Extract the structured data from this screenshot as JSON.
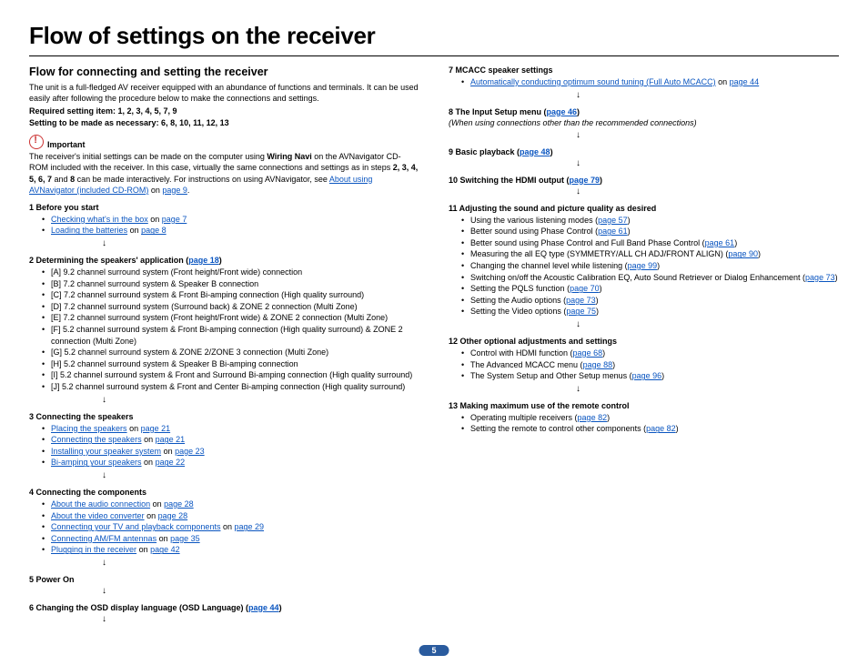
{
  "title": "Flow of settings on the receiver",
  "subtitle": "Flow for connecting and setting the receiver",
  "intro1": "The unit is a full-fledged AV receiver equipped with an abundance of functions and terminals. It can be used easily after following the procedure below to make the connections and settings.",
  "req_label": "Required setting item",
  "req_val": ": 1, 2, 3, 4, 5, 7, 9",
  "asnec_label": "Setting to be made as necessary",
  "asnec_val": ": 6, 8, 10, 11, 12, 13",
  "important_label": "Important",
  "important_a": "The receiver's initial settings can be made on the computer using ",
  "important_wn": "Wiring Navi",
  "important_b": " on the AVNavigator CD-ROM included with the receiver. In this case, virtually the same connections and settings as in steps ",
  "important_steps": "2, 3, 4, 5, 6, 7",
  "important_c": " and ",
  "important_8": "8",
  "important_d": " can be made interactively. For instructions on using AVNavigator, see ",
  "important_link": "About using AVNavigator (included CD-ROM)",
  "important_e": " on ",
  "important_pg": "page 9",
  "s1_head": "1    Before you start",
  "s1a_a": "Checking what's in the box",
  "s1a_b": " on ",
  "s1a_pg": "page 7",
  "s1b_a": "Loading the batteries",
  "s1b_b": " on ",
  "s1b_pg": "page 8",
  "s2_head_a": "2    Determining the speakers' application (",
  "s2_head_pg": "page 18",
  "s2_head_b": ")",
  "s2_A": "[A] 9.2 channel surround system (Front height/Front wide) connection",
  "s2_B": "[B] 7.2 channel surround system & Speaker B connection",
  "s2_C": "[C] 7.2 channel surround system & Front Bi-amping connection (High quality surround)",
  "s2_D": "[D] 7.2 channel surround system (Surround back) & ZONE 2 connection (Multi Zone)",
  "s2_E": "[E] 7.2 channel surround system (Front height/Front wide) & ZONE 2 connection (Multi Zone)",
  "s2_F": "[F] 5.2 channel surround system & Front Bi-amping connection (High quality surround) & ZONE 2 connection (Multi Zone)",
  "s2_G": "[G] 5.2 channel surround system & ZONE 2/ZONE 3 connection (Multi Zone)",
  "s2_H": "[H] 5.2 channel surround system & Speaker B Bi-amping connection",
  "s2_I": "[I] 5.2 channel surround system & Front and Surround Bi-amping connection (High quality surround)",
  "s2_J": "[J] 5.2 channel surround system & Front and Center Bi-amping connection (High quality surround)",
  "s3_head": "3    Connecting the speakers",
  "s3a_a": "Placing the speakers",
  "s3a_b": " on ",
  "s3a_pg": "page 21",
  "s3b_a": "Connecting the speakers",
  "s3b_b": " on ",
  "s3b_pg": "page 21",
  "s3c_a": "Installing your speaker system",
  "s3c_b": " on ",
  "s3c_pg": "page 23",
  "s3d_a": "Bi-amping your speakers",
  "s3d_b": " on ",
  "s3d_pg": "page 22",
  "s4_head": "4    Connecting the components",
  "s4a_a": "About the audio connection",
  "s4a_b": " on ",
  "s4a_pg": "page 28",
  "s4b_a": "About the video converter",
  "s4b_b": " on ",
  "s4b_pg": "page 28",
  "s4c_a": "Connecting your TV and playback components",
  "s4c_b": " on ",
  "s4c_pg": "page 29",
  "s4d_a": "Connecting AM/FM antennas",
  "s4d_b": " on ",
  "s4d_pg": "page 35",
  "s4e_a": "Plugging in the receiver",
  "s4e_b": " on ",
  "s4e_pg": "page 42",
  "s5_head": "5    Power On",
  "s6_head_a": "6    Changing the OSD display language (OSD Language) (",
  "s6_head_pg": "page 44",
  "s6_head_b": ")",
  "s7_head": "7    MCACC speaker settings",
  "s7a_a": "Automatically conducting optimum sound tuning (Full Auto MCACC)",
  "s7a_b": " on ",
  "s7a_pg": "page 44",
  "s8_head_a": "8    The Input Setup menu (",
  "s8_head_pg": "page 46",
  "s8_head_b": ")",
  "s8_note": "(When using connections other than the recommended connections)",
  "s9_head_a": "9    Basic playback (",
  "s9_head_pg": "page 48",
  "s9_head_b": ")",
  "s10_head_a": "10  Switching the HDMI output (",
  "s10_head_pg": "page 79",
  "s10_head_b": ")",
  "s11_head": "11  Adjusting the sound and picture quality as desired",
  "s11a_a": "Using the various listening modes (",
  "s11a_pg": "page 57",
  "s11a_b": ")",
  "s11b_a": "Better sound using Phase Control (",
  "s11b_pg": "page 61",
  "s11b_b": ")",
  "s11c_a": "Better sound using Phase Control and Full Band Phase Control (",
  "s11c_pg": "page 61",
  "s11c_b": ")",
  "s11d_a": "Measuring the all EQ type (SYMMETRY/ALL CH ADJ/FRONT ALIGN) (",
  "s11d_pg": "page 90",
  "s11d_b": ")",
  "s11e_a": "Changing the channel level while listening (",
  "s11e_pg": "page 99",
  "s11e_b": ")",
  "s11f_a": "Switching on/off the Acoustic Calibration EQ, Auto Sound Retriever or Dialog Enhancement (",
  "s11f_pg": "page 73",
  "s11f_b": ")",
  "s11g_a": "Setting the PQLS function (",
  "s11g_pg": "page 70",
  "s11g_b": ")",
  "s11h_a": "Setting the Audio options (",
  "s11h_pg": "page 73",
  "s11h_b": ")",
  "s11i_a": "Setting the Video options (",
  "s11i_pg": "page 75",
  "s11i_b": ")",
  "s12_head": "12  Other optional adjustments and settings",
  "s12a_a": "Control with HDMI function (",
  "s12a_pg": "page 68",
  "s12a_b": ")",
  "s12b_a": "The Advanced MCACC menu (",
  "s12b_pg": "page 88",
  "s12b_b": ")",
  "s12c_a": "The System Setup and Other Setup menus (",
  "s12c_pg": "page 96",
  "s12c_b": ")",
  "s13_head": "13  Making maximum use of the remote control",
  "s13a_a": "Operating multiple receivers (",
  "s13a_pg": "page 82",
  "s13a_b": ")",
  "s13b_a": "Setting the remote to control other components (",
  "s13b_pg": "page 82",
  "s13b_b": ")",
  "arrow": "↓",
  "page_num": "5"
}
